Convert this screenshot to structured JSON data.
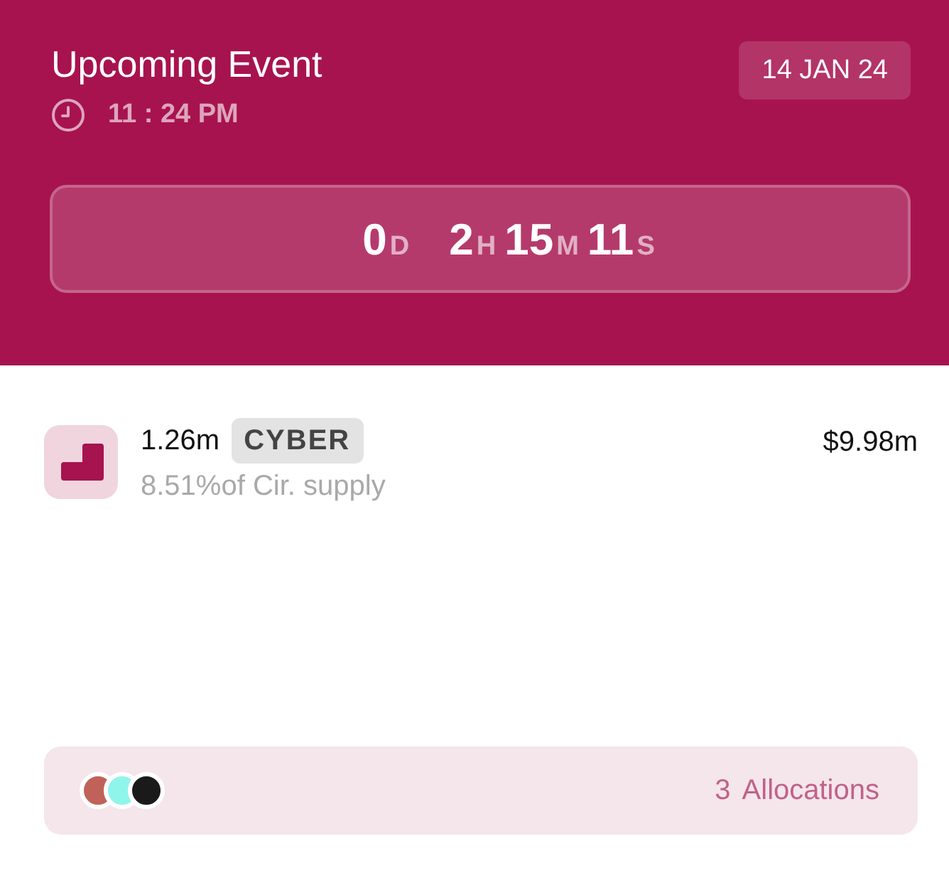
{
  "header": {
    "title": "Upcoming Event",
    "time": "11 : 24 PM",
    "date": "14 JAN 24"
  },
  "countdown": [
    {
      "value": "0",
      "unit": "D"
    },
    {
      "value": "2",
      "unit": "H"
    },
    {
      "value": "15",
      "unit": "M"
    },
    {
      "value": "11",
      "unit": "S"
    }
  ],
  "token": {
    "amount": "1.26m",
    "symbol": "CYBER",
    "supply": "8.51%of Cir. supply",
    "value": "$9.98m"
  },
  "allocations": {
    "dots": [
      {
        "color": "#c0625a"
      },
      {
        "color": "#8ff5ea"
      },
      {
        "color": "#1a1a1a"
      }
    ],
    "count": "3",
    "label": "Allocations"
  }
}
